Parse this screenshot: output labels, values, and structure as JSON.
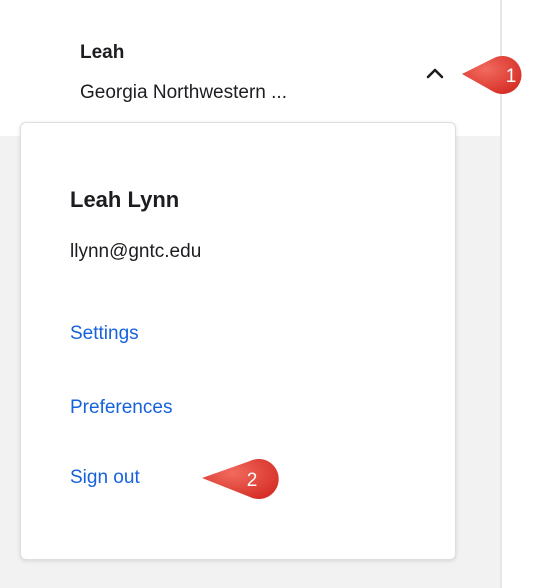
{
  "header": {
    "user_first_name": "Leah",
    "user_org": "Georgia Northwestern ..."
  },
  "dropdown": {
    "full_name": "Leah Lynn",
    "email": "llynn@gntc.edu",
    "links": {
      "settings": "Settings",
      "preferences": "Preferences",
      "sign_out": "Sign out"
    }
  },
  "callouts": {
    "first": "1",
    "second": "2"
  },
  "colors": {
    "link": "#1662dd",
    "callout": "#e53935",
    "text": "#1d1d21"
  }
}
